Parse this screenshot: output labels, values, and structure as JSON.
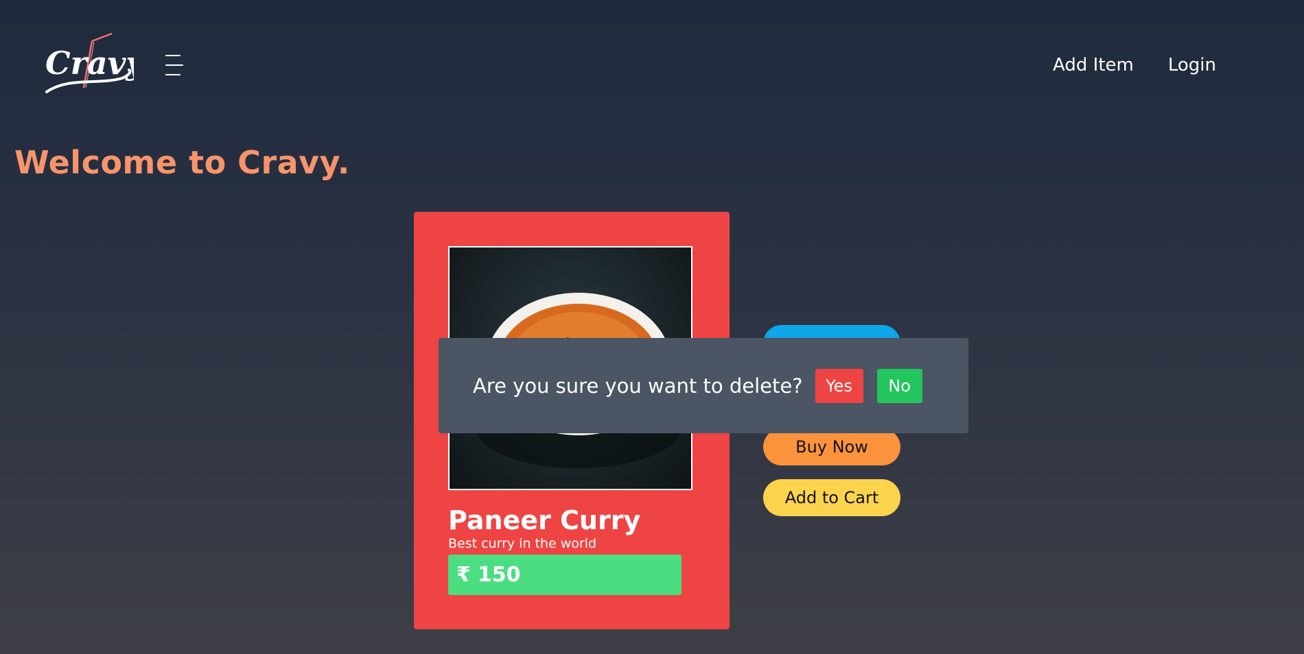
{
  "header": {
    "logo_text": "Cravy",
    "menu_icon": "hamburger-menu-icon",
    "nav": {
      "add_item": "Add Item",
      "login": "Login"
    }
  },
  "main": {
    "welcome": "Welcome to Cravy."
  },
  "product": {
    "title": "Paneer Curry",
    "description": "Best curry in the world",
    "currency": "₹",
    "price": "150",
    "image_icon": "curry-bowl-image"
  },
  "actions": {
    "buy_now": "Buy Now",
    "add_to_cart": "Add to Cart"
  },
  "dialog": {
    "message": "Are you sure you want to delete?",
    "yes": "Yes",
    "no": "No"
  },
  "colors": {
    "accent": "#f7946a",
    "card": "#ef4444",
    "price": "#4ade80",
    "buy": "#fb923c",
    "cart": "#fcd34d",
    "hidden_button": "#0ea5e9",
    "dialog": "#4b5563",
    "yes": "#ef4444",
    "no": "#22c55e"
  }
}
